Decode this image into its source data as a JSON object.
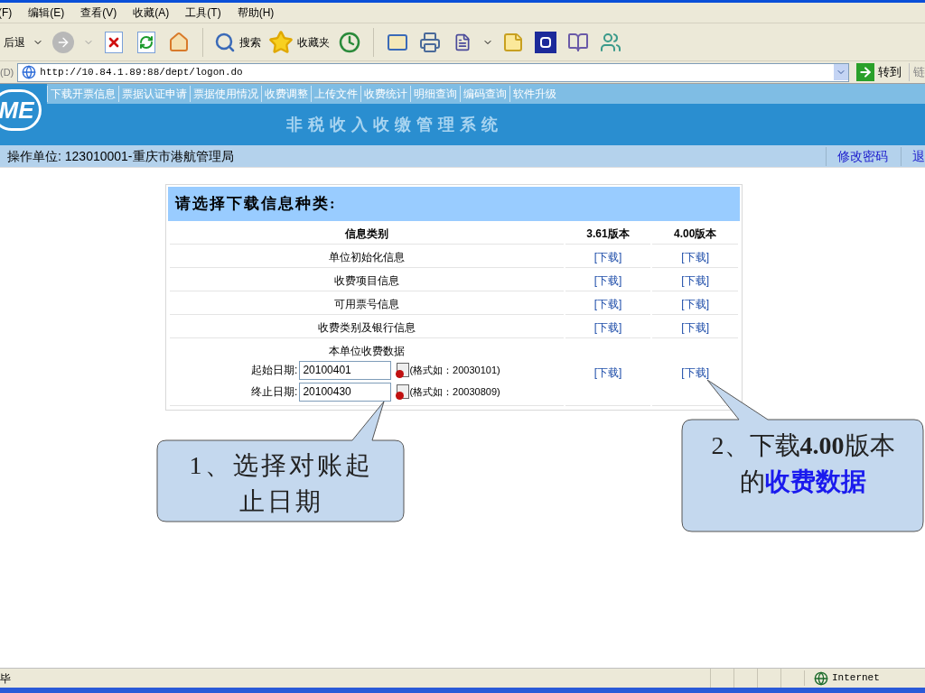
{
  "menu": [
    "(F)",
    "编辑(E)",
    "查看(V)",
    "收藏(A)",
    "工具(T)",
    "帮助(H)"
  ],
  "toolbar": {
    "back": "后退",
    "search": "搜索",
    "favorites": "收藏夹"
  },
  "address": {
    "label": "(D)",
    "url": "http://10.84.1.89:88/dept/logon.do",
    "go": "转到",
    "links": "链"
  },
  "header": {
    "logo": "ME",
    "nav": [
      "下载开票信息",
      "票据认证申请",
      "票据使用情况",
      "收费调整",
      "上传文件",
      "收费统计",
      "明细查询",
      "编码查询",
      "软件升级"
    ],
    "title": "非税收入收缴管理系统"
  },
  "operator": {
    "text": "操作单位: 123010001-重庆市港航管理局",
    "links": [
      "修改密码",
      "退"
    ]
  },
  "panel": {
    "title": "请选择下载信息种类:",
    "columns": [
      "信息类别",
      "3.61版本",
      "4.00版本"
    ],
    "rows": [
      {
        "category": "单位初始化信息",
        "links": [
          "[下载]",
          "[下载]"
        ]
      },
      {
        "category": "收费项目信息",
        "links": [
          "[下载]",
          "[下载]"
        ]
      },
      {
        "category": "可用票号信息",
        "links": [
          "[下载]",
          "[下载]"
        ]
      },
      {
        "category": "收费类别及银行信息",
        "links": [
          "[下载]",
          "[下载]"
        ]
      }
    ],
    "data_row": {
      "category": "本单位收费数据",
      "fields": [
        {
          "label": "起始日期:",
          "value": "20100401",
          "hint": "(格式如：20030101)"
        },
        {
          "label": "终止日期:",
          "value": "20100430",
          "hint": "(格式如：20030809)"
        }
      ],
      "links": [
        "[下载]",
        "[下载]"
      ]
    }
  },
  "callouts": [
    {
      "parts": [
        {
          "kind": "plain",
          "text": "1、选择对账起止日期"
        }
      ]
    },
    {
      "parts": [
        {
          "kind": "plain",
          "text": "2、下载"
        },
        {
          "kind": "bold",
          "text": "4.00"
        },
        {
          "kind": "plain",
          "text": "版本的"
        },
        {
          "kind": "highlight",
          "text": "收费数据"
        }
      ]
    }
  ],
  "status": {
    "text": "毕",
    "zone": "Internet"
  }
}
